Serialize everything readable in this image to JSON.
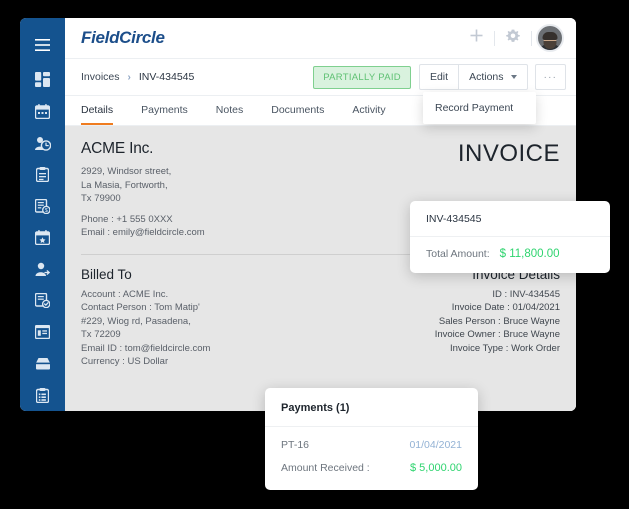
{
  "app": {
    "brand": "FieldCircle",
    "menu_icon": "hamburger-icon"
  },
  "sidebar": {
    "items": [
      {
        "icon": "dashboard-grid-icon"
      },
      {
        "icon": "calendar-icon"
      },
      {
        "icon": "person-clock-icon"
      },
      {
        "icon": "clipboard-icon"
      },
      {
        "icon": "invoice-dollar-icon"
      },
      {
        "icon": "calendar-star-icon"
      },
      {
        "icon": "person-arrow-icon"
      },
      {
        "icon": "document-check-icon"
      },
      {
        "icon": "list-card-icon"
      },
      {
        "icon": "inbox-icon"
      },
      {
        "icon": "clipboard-list-icon"
      }
    ]
  },
  "topbar": {
    "add_icon": "plus-icon",
    "settings_icon": "gear-icon",
    "avatar": "user-avatar"
  },
  "breadcrumb": {
    "parent": "Invoices",
    "separator": "›",
    "current": "INV-434545"
  },
  "actions": {
    "status_badge": "PARTIALLY PAID",
    "edit_label": "Edit",
    "actions_label": "Actions",
    "more_label": "···",
    "dropdown_items": [
      "Record Payment"
    ]
  },
  "tabs": [
    {
      "label": "Details",
      "active": true
    },
    {
      "label": "Payments",
      "active": false
    },
    {
      "label": "Notes",
      "active": false
    },
    {
      "label": "Documents",
      "active": false
    },
    {
      "label": "Activity",
      "active": false
    }
  ],
  "document": {
    "title": "INVOICE",
    "company": {
      "name": "ACME Inc.",
      "address_lines": [
        "2929, Windsor street,",
        "La Masia, Fortworth,",
        "Tx 79900"
      ],
      "phone": "Phone : +1 555 0XXX",
      "email": "Email : emily@fieldcircle.com"
    },
    "billed_to": {
      "heading": "Billed To",
      "lines": [
        "Account : ACME Inc.",
        "Contact Person : Tom Matip'",
        "#229, Wiog rd, Pasadena,",
        "Tx 72209",
        "Email ID : tom@fieldcircle.com",
        "Currency : US Dollar"
      ]
    },
    "invoice_details": {
      "heading": "Invoice Details",
      "lines": [
        "ID : INV-434545",
        "Invoice Date : 01/04/2021",
        "Sales Person : Bruce Wayne",
        "Invoice Owner : Bruce Wayne",
        "Invoice Type : Work Order"
      ]
    }
  },
  "invoice_card": {
    "number": "INV-434545",
    "total_label": "Total Amount:",
    "total_amount": "$ 11,800.00"
  },
  "payments_card": {
    "heading": "Payments (1)",
    "payment_id": "PT-16",
    "payment_date": "01/04/2021",
    "amount_label": "Amount Received :",
    "amount_value": "$ 5,000.00"
  },
  "colors": {
    "sidebar": "#14538f",
    "brand": "#1c4e8a",
    "accent_tab": "#ef7c20",
    "status_green": "#5fc173",
    "money_green": "#2fd46f",
    "sheet_bg": "#e6e6e6"
  }
}
